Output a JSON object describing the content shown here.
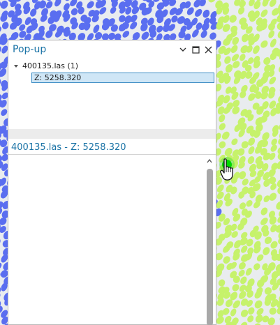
{
  "panel": {
    "title": "Pop-up",
    "tree_root_label": "400135.las (1)",
    "tree_child_label": "Z: 5258.320",
    "detail_title": "400135.las - Z: 5258.320"
  },
  "icons": {
    "menu": "chevron-down-icon",
    "maximize": "maximize-icon",
    "close": "close-icon",
    "expand": "tree-expand-caret-icon",
    "scroll_up": "scroll-up-arrow-icon",
    "cursor": "hand-pointer-cursor-icon"
  },
  "colors": {
    "map_background": "#e9ecef",
    "points_blue": "#5a6ef0",
    "points_green": "#c6f26b",
    "title_blue": "#1a73a6",
    "selection_fill": "#cfe6f6",
    "selection_border": "#3c8cc4",
    "highlight_green": "#22dd22"
  }
}
